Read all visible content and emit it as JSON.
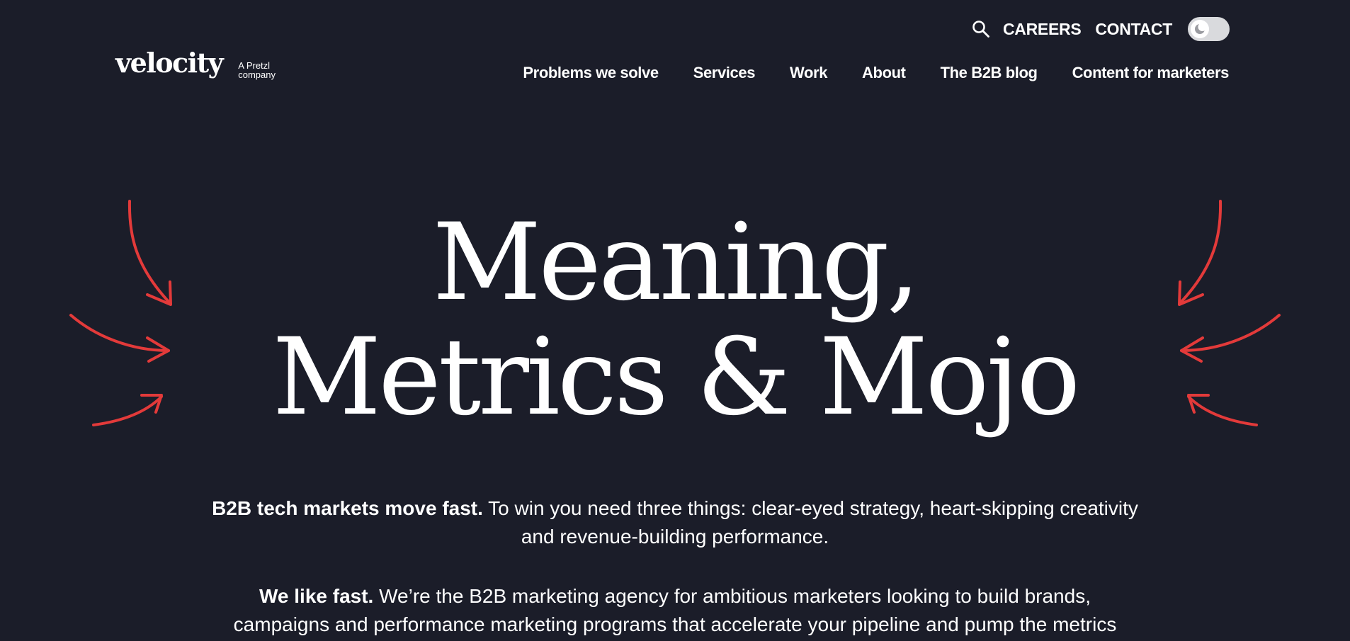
{
  "utility": {
    "search_icon": "search-icon",
    "careers": "CAREERS",
    "contact": "CONTACT",
    "theme_toggle_icon": "moon-icon",
    "theme_toggle_state": "light"
  },
  "logo": {
    "word": "velocity",
    "sub_line1": "A Pretzl",
    "sub_line2": "company"
  },
  "nav": [
    {
      "label": "Problems we solve"
    },
    {
      "label": "Services"
    },
    {
      "label": "Work"
    },
    {
      "label": "About"
    },
    {
      "label": "The B2B blog"
    },
    {
      "label": "Content for marketers"
    }
  ],
  "hero": {
    "title_line1": "Meaning,",
    "title_line2": "Metrics & Mojo",
    "arrow_color": "#e33a3a"
  },
  "intro": {
    "p1_bold": "B2B tech markets move fast.",
    "p1_rest_a": " To win you need three things: clear-eyed strategy, heart-skipping creativity",
    "p1_rest_b": "and revenue-building performance.",
    "p2_bold": "We like fast.",
    "p2_rest_a": " We’re the B2B marketing agency for ambitious marketers looking to build brands,",
    "p2_rest_b": "campaigns and performance marketing programs that accelerate your pipeline and pump the metrics"
  },
  "colors": {
    "background": "#1b1d29",
    "text": "#ffffff",
    "accent": "#e33a3a"
  }
}
